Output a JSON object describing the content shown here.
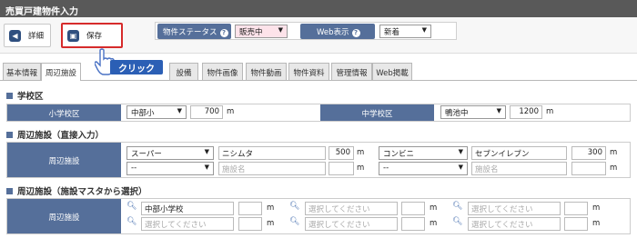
{
  "window": {
    "title": "売買戸建物件入力"
  },
  "toolbar": {
    "detail_label": "詳細",
    "save_label": "保存",
    "status_label": "物件ステータス",
    "status_value": "販売中",
    "web_label": "Web表示",
    "web_value": "新着",
    "help_mark": "?"
  },
  "callout": {
    "text": "クリック"
  },
  "tabs": [
    {
      "label": "基本情報"
    },
    {
      "label": "周辺施設"
    },
    {
      "label": "設備"
    },
    {
      "label": "物件画像"
    },
    {
      "label": "物件動画"
    },
    {
      "label": "物件資料"
    },
    {
      "label": "管理情報"
    },
    {
      "label": "Web掲載"
    }
  ],
  "school": {
    "title": "学校区",
    "elem_label": "小学校区",
    "elem_value": "中部小",
    "elem_dist": "700",
    "junior_label": "中学校区",
    "junior_value": "鴨池中",
    "junior_dist": "1200",
    "unit": "m"
  },
  "facilities_direct": {
    "title": "周辺施設（直接入力）",
    "row_label": "周辺施設",
    "rows": [
      {
        "type1": "スーパー",
        "name1": "ニシムタ",
        "dist1": "500",
        "type2": "コンビニ",
        "name2": "セブンイレブン",
        "dist2": "300"
      },
      {
        "type1": "--",
        "name1": "",
        "dist1": "",
        "type2": "--",
        "name2": "",
        "dist2": ""
      }
    ],
    "name_placeholder": "施設名",
    "unit": "m"
  },
  "facilities_master": {
    "title": "周辺施設（施設マスタから選択）",
    "row_label": "周辺施設",
    "rows": [
      {
        "c1": "中部小学校",
        "c2": "",
        "c3": ""
      },
      {
        "c1": "",
        "c2": "",
        "c3": ""
      }
    ],
    "placeholder": "選択してください",
    "unit": "m"
  },
  "colors": {
    "accent": "#556f9a",
    "title_bar": "#595959",
    "highlight": "#d62b2b",
    "callout": "#2b5fb5"
  }
}
